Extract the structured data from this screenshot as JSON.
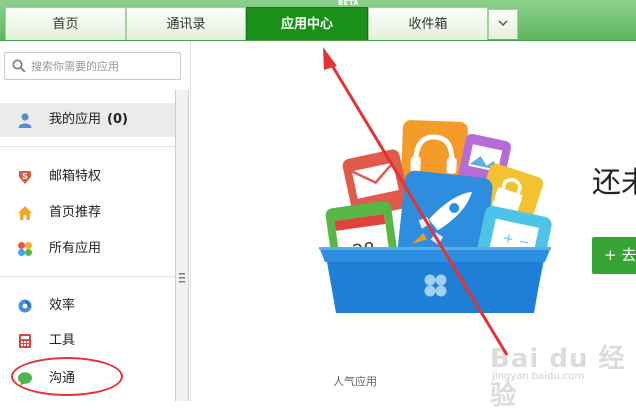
{
  "tabs": [
    {
      "label": "首页",
      "active": false
    },
    {
      "label": "通讯录",
      "active": false
    },
    {
      "label": "应用中心",
      "active": true,
      "badge": "BETA"
    },
    {
      "label": "收件箱",
      "active": false
    }
  ],
  "tab_more_icon": "chevron-down-icon",
  "search": {
    "placeholder": "搜索你需要的应用",
    "icon": "search-icon"
  },
  "sidebar": {
    "my_apps": {
      "label": "我的应用",
      "count": "(0)",
      "icon": "user-icon"
    },
    "group1": [
      {
        "label": "邮箱特权",
        "icon": "privilege-shield-icon"
      },
      {
        "label": "首页推荐",
        "icon": "home-icon"
      },
      {
        "label": "所有应用",
        "icon": "apps-clover-icon"
      }
    ],
    "group2": [
      {
        "label": "效率",
        "icon": "efficiency-icon"
      },
      {
        "label": "工具",
        "icon": "calculator-icon"
      },
      {
        "label": "沟通",
        "icon": "chat-bubble-icon"
      }
    ]
  },
  "main": {
    "headline": "还未",
    "add_button": "+ 去",
    "calendar_day": "28",
    "popular_label": "人气应用"
  },
  "watermark": {
    "text": "Bai du 经验",
    "sub": "jingyan.baidu.com"
  },
  "colors": {
    "tab_active": "#1a8f1a",
    "tab_bar": "#5db75d",
    "annotation": "#e53333",
    "button": "#35a435"
  }
}
